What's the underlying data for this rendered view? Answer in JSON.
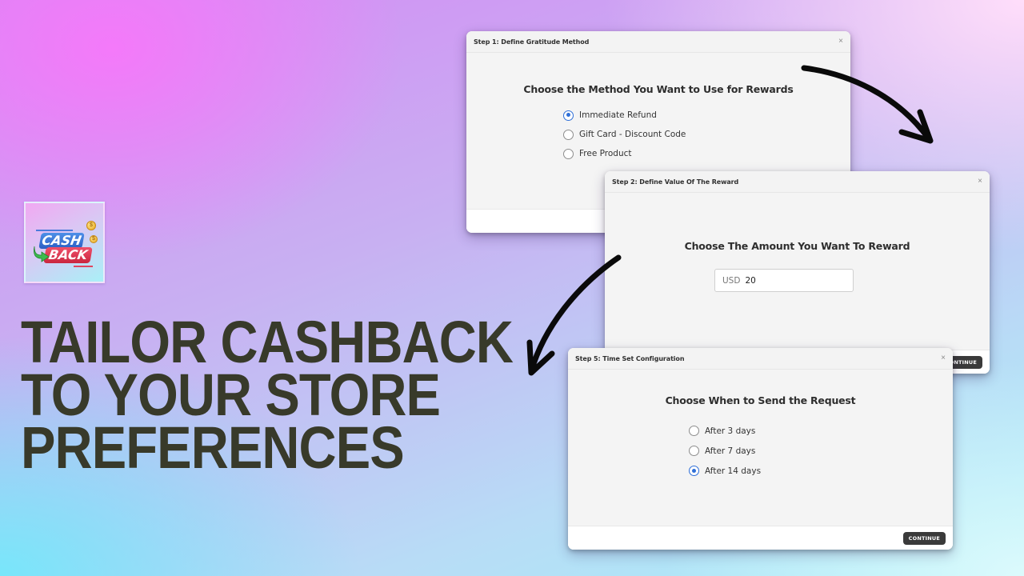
{
  "brand": {
    "logo": {
      "line1": "CASH",
      "line2": "BACK",
      "icons": [
        "green-arrow-icon",
        "gold-coin-icon",
        "gold-coin-icon"
      ],
      "coin_symbol": "$"
    }
  },
  "headline": {
    "lines": [
      "TAILOR CASHBACK",
      "TO YOUR STORE",
      "PREFERENCES"
    ],
    "color": "#383A2A"
  },
  "dialogs": {
    "step1": {
      "title": "Step 1: Define Gratitude Method",
      "close_icon": "×",
      "question": "Choose the Method You Want to Use for Rewards",
      "options": [
        {
          "label": "Immediate Refund",
          "selected": true
        },
        {
          "label": "Gift Card - Discount Code",
          "selected": false
        },
        {
          "label": "Free Product",
          "selected": false
        }
      ]
    },
    "step2": {
      "title": "Step 2: Define Value Of The Reward",
      "close_icon": "×",
      "question": "Choose The Amount You Want To Reward",
      "amount": {
        "currency": "USD",
        "value": "20"
      },
      "continue_label": "CONTINUE"
    },
    "step5": {
      "title": "Step 5: Time Set Configuration",
      "close_icon": "×",
      "question": "Choose When to Send the Request",
      "options": [
        {
          "label": "After 3 days",
          "selected": false
        },
        {
          "label": "After 7 days",
          "selected": false
        },
        {
          "label": "After 14 days",
          "selected": true
        }
      ],
      "continue_label": "CONTINUE"
    }
  },
  "colors": {
    "accent_radio": "#2F6FD8",
    "button_dark": "#3A3A3A",
    "arrow": "#0A0A0A"
  }
}
